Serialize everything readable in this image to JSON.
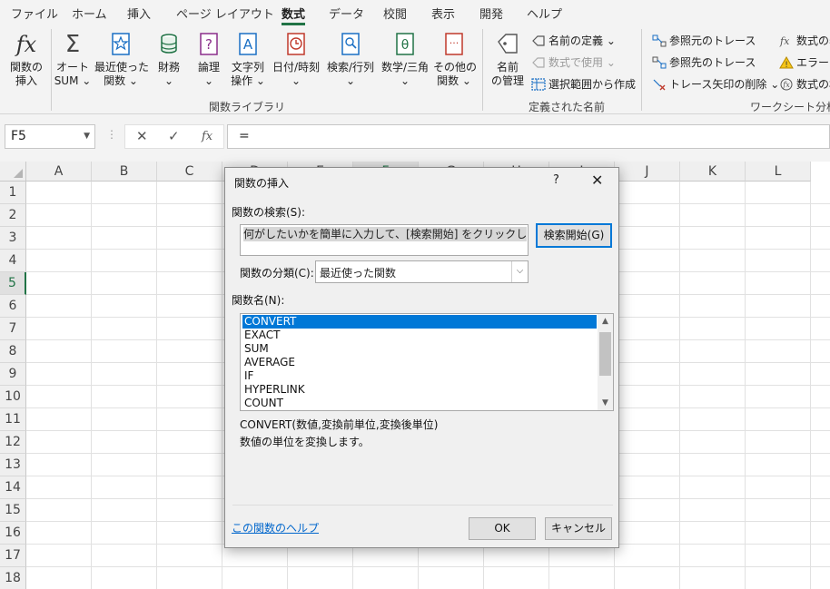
{
  "tabs": {
    "items": [
      "ファイル",
      "ホーム",
      "挿入",
      "ページ レイアウト",
      "数式",
      "データ",
      "校閲",
      "表示",
      "開発",
      "ヘルプ"
    ],
    "active": "数式"
  },
  "ribbon": {
    "insert_function": {
      "line1": "関数の",
      "line2": "挿入",
      "icon": "fx"
    },
    "autosum": {
      "line1": "オート",
      "line2": "SUM ⌄",
      "icon": "Σ"
    },
    "recent": {
      "line1": "最近使った",
      "line2": "関数 ⌄"
    },
    "financial": {
      "line1": "財務",
      "line2": "⌄"
    },
    "logical": {
      "line1": "論理",
      "line2": "⌄",
      "icon": "?"
    },
    "text": {
      "line1": "文字列",
      "line2": "操作 ⌄",
      "icon": "A"
    },
    "datetime": {
      "line1": "日付/時刻",
      "line2": "⌄"
    },
    "lookup": {
      "line1": "検索/行列",
      "line2": "⌄"
    },
    "math": {
      "line1": "数学/三角",
      "line2": "⌄",
      "icon": "θ"
    },
    "more": {
      "line1": "その他の",
      "line2": "関数 ⌄",
      "icon": "···"
    },
    "group_library": "関数ライブラリ",
    "name_manager": {
      "line1": "名前",
      "line2": "の管理"
    },
    "define_name": "名前の定義 ⌄",
    "use_in_formula": "数式で使用 ⌄",
    "create_from_selection": "選択範囲から作成",
    "group_names": "定義された名前",
    "trace_precedents": "参照元のトレース",
    "trace_dependents": "参照先のトレース",
    "remove_arrows": "トレース矢印の削除 ⌄",
    "show_formulas": "数式の表",
    "error_check": "エラー チ",
    "evaluate_formula": "数式の検",
    "group_audit": "ワークシート分析"
  },
  "formula_bar": {
    "name_box": "F5",
    "cancel": "✕",
    "enter": "✓",
    "fx": "fx",
    "content": "="
  },
  "grid": {
    "columns": [
      "A",
      "B",
      "C",
      "D",
      "E",
      "F",
      "G",
      "H",
      "I",
      "J",
      "K",
      "L"
    ],
    "rows": [
      "1",
      "2",
      "3",
      "4",
      "5",
      "6",
      "7",
      "8",
      "9",
      "10",
      "11",
      "12",
      "13",
      "14",
      "15",
      "16",
      "17",
      "18"
    ],
    "selected_row": "5",
    "selected_col": "F"
  },
  "dialog": {
    "title": "関数の挿入",
    "help": "?",
    "close": "✕",
    "search_label": "関数の検索(S):",
    "search_value": "何がしたいかを簡単に入力して、[検索開始] をクリックしてください。",
    "search_button": "検索開始(G)",
    "category_label": "関数の分類(C):",
    "category_value": "最近使った関数",
    "name_label": "関数名(N):",
    "functions": [
      "CONVERT",
      "EXACT",
      "SUM",
      "AVERAGE",
      "IF",
      "HYPERLINK",
      "COUNT"
    ],
    "selected_function": "CONVERT",
    "syntax": "CONVERT(数値,変換前単位,変換後単位)",
    "description": "数値の単位を変換します。",
    "help_link": "この関数のヘルプ",
    "ok": "OK",
    "cancel": "キャンセル"
  }
}
